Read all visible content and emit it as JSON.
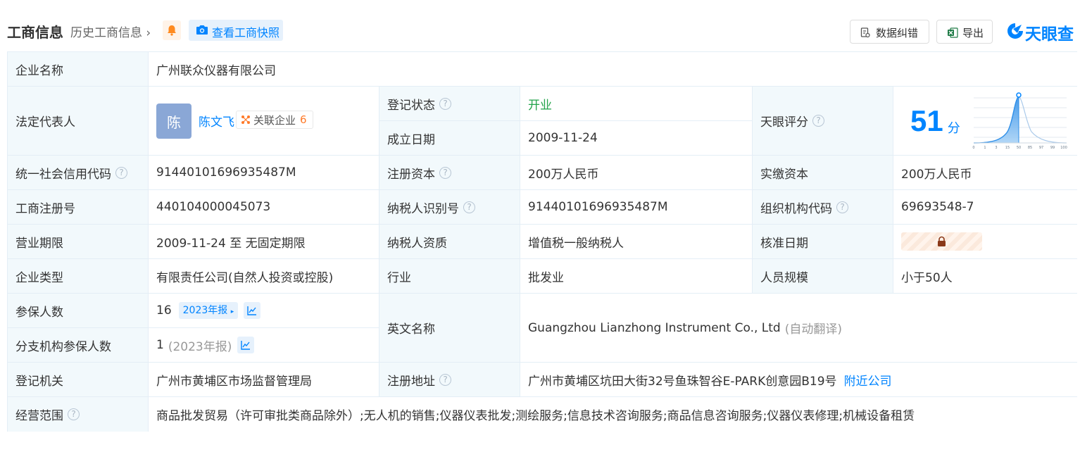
{
  "header": {
    "title": "工商信息",
    "history_link": "历史工商信息",
    "snapshot_button": "查看工商快照",
    "error_button": "数据纠错",
    "export_button": "导出",
    "brand": "天眼查"
  },
  "company": {
    "name_label": "企业名称",
    "name": "广州联众仪器有限公司",
    "legal_label": "法定代表人",
    "legal_avatar": "陈",
    "legal_name": "陈文飞",
    "related_label": "关联企业",
    "related_count": "6",
    "reg_status_label": "登记状态",
    "reg_status": "开业",
    "found_date_label": "成立日期",
    "found_date": "2009-11-24",
    "score_label": "天眼评分",
    "score": "51",
    "score_unit": "分",
    "score_axis": [
      "0",
      "1",
      "3",
      "15",
      "50",
      "85",
      "97",
      "99",
      "100"
    ],
    "credit_code_label": "统一社会信用代码",
    "credit_code": "91440101696935487M",
    "reg_capital_label": "注册资本",
    "reg_capital": "200万人民币",
    "paid_capital_label": "实缴资本",
    "paid_capital": "200万人民币",
    "reg_no_label": "工商注册号",
    "reg_no": "440104000045073",
    "taxpayer_id_label": "纳税人识别号",
    "taxpayer_id": "91440101696935487M",
    "org_code_label": "组织机构代码",
    "org_code": "69693548-7",
    "term_label": "营业期限",
    "term": "2009-11-24 至 无固定期限",
    "taxpayer_qual_label": "纳税人资质",
    "taxpayer_qual": "增值税一般纳税人",
    "approve_date_label": "核准日期",
    "type_label": "企业类型",
    "type": "有限责任公司(自然人投资或控股)",
    "industry_label": "行业",
    "industry": "批发业",
    "staff_label": "人员规模",
    "staff": "小于50人",
    "insured_label": "参保人数",
    "insured": "16",
    "insured_year": "2023年报",
    "branch_insured_label": "分支机构参保人数",
    "branch_insured": "1",
    "branch_insured_year": "(2023年报)",
    "en_name_label": "英文名称",
    "en_name": "Guangzhou Lianzhong Instrument Co., Ltd",
    "en_name_note": "(自动翻译)",
    "authority_label": "登记机关",
    "authority": "广州市黄埔区市场监督管理局",
    "address_label": "注册地址",
    "address": "广州市黄埔区坑田大街32号鱼珠智谷E-PARK创意园B19号",
    "nearby_link": "附近公司",
    "scope_label": "经营范围",
    "scope": "商品批发贸易（许可审批类商品除外）;无人机的销售;仪器仪表批发;测绘服务;信息技术咨询服务;商品信息咨询服务;仪器仪表修理;机械设备租赁"
  },
  "colors": {
    "accent": "#0084ff",
    "status_green": "#22a34a",
    "label_bg": "#f2f9fc",
    "border": "#e4eef6",
    "related_count": "#ff7a29"
  }
}
